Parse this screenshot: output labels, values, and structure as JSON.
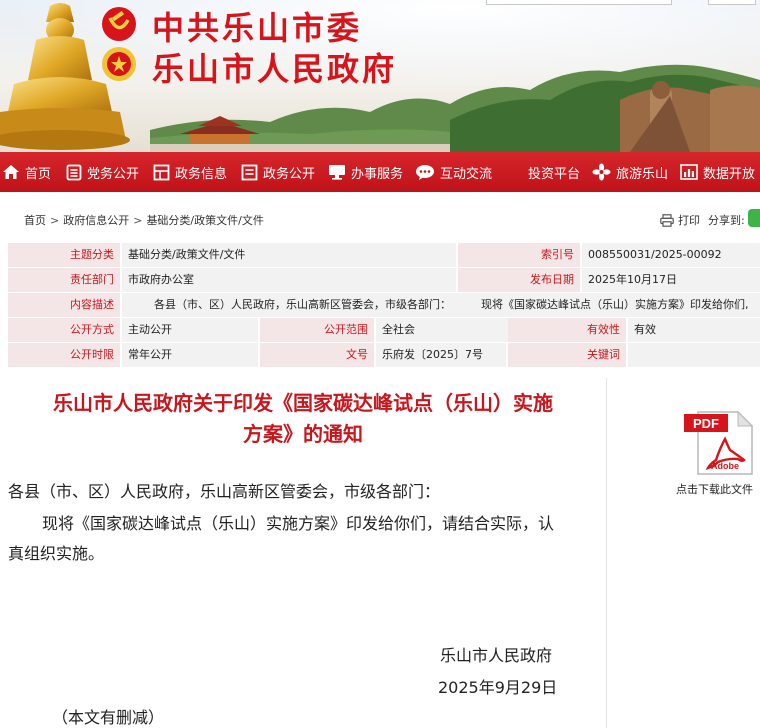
{
  "header": {
    "title_line1": "中共乐山市委",
    "title_line2": "乐山市人民政府",
    "accent_color": "#d7141b"
  },
  "nav": {
    "items": [
      {
        "label": "首页",
        "icon": "home-icon"
      },
      {
        "label": "党务公开",
        "icon": "document-icon"
      },
      {
        "label": "政务信息",
        "icon": "grid-icon"
      },
      {
        "label": "政务公开",
        "icon": "board-icon"
      },
      {
        "label": "办事服务",
        "icon": "monitor-icon"
      },
      {
        "label": "互动交流",
        "icon": "chat-bubble-icon"
      },
      {
        "label": "投资平台",
        "icon": ""
      },
      {
        "label": "旅游乐山",
        "icon": "flower-icon"
      },
      {
        "label": "数据开放",
        "icon": "bar-chart-icon"
      }
    ],
    "background_color": "#c8161d"
  },
  "breadcrumb": {
    "items": [
      "首页",
      "政府信息公开",
      "基础分类/政策文件/文件"
    ],
    "separator": ">"
  },
  "tools": {
    "print_label": "打印",
    "share_label": "分享到:"
  },
  "info_table": {
    "topic_category_label": "主题分类",
    "topic_category_value": "基础分类/政策文件/文件",
    "index_no_label": "索引号",
    "index_no_value": "008550031/2025-00092",
    "department_label": "责任部门",
    "department_value": "市政府办公室",
    "publish_date_label": "发布日期",
    "publish_date_value": "2025年10月17日",
    "summary_label": "内容描述",
    "summary_value_part1": "各县（市、区）人民政府，乐山高新区管委会，市级各部门：",
    "summary_value_part2": "现将《国家碳达峰试点（乐山）实施方案》印发给你们,",
    "disclosure_mode_label": "公开方式",
    "disclosure_mode_value": "主动公开",
    "disclosure_scope_label": "公开范围",
    "disclosure_scope_value": "全社会",
    "validity_label": "有效性",
    "validity_value": "有效",
    "disclosure_period_label": "公开时限",
    "disclosure_period_value": "常年公开",
    "doc_no_label": "文号",
    "doc_no_value": "乐府发〔2025〕7号",
    "keywords_label": "关键词",
    "keywords_value": ""
  },
  "article": {
    "title_line1": "乐山市人民政府关于印发《国家碳达峰试点（乐山）实施",
    "title_line2": "方案》的通知",
    "addressee": "各县（市、区）人民政府，乐山高新区管委会，市级各部门：",
    "body_line1": "现将《国家碳达峰试点（乐山）实施方案》印发给你们，请结合实际，认",
    "body_line2": "真组织实施。",
    "signature": "乐山市人民政府",
    "date": "2025年9月29日",
    "note": "（本文有删减）"
  },
  "download": {
    "badge_text": "PDF",
    "brand_text": "Adobe",
    "label": "点击下载此文件"
  }
}
